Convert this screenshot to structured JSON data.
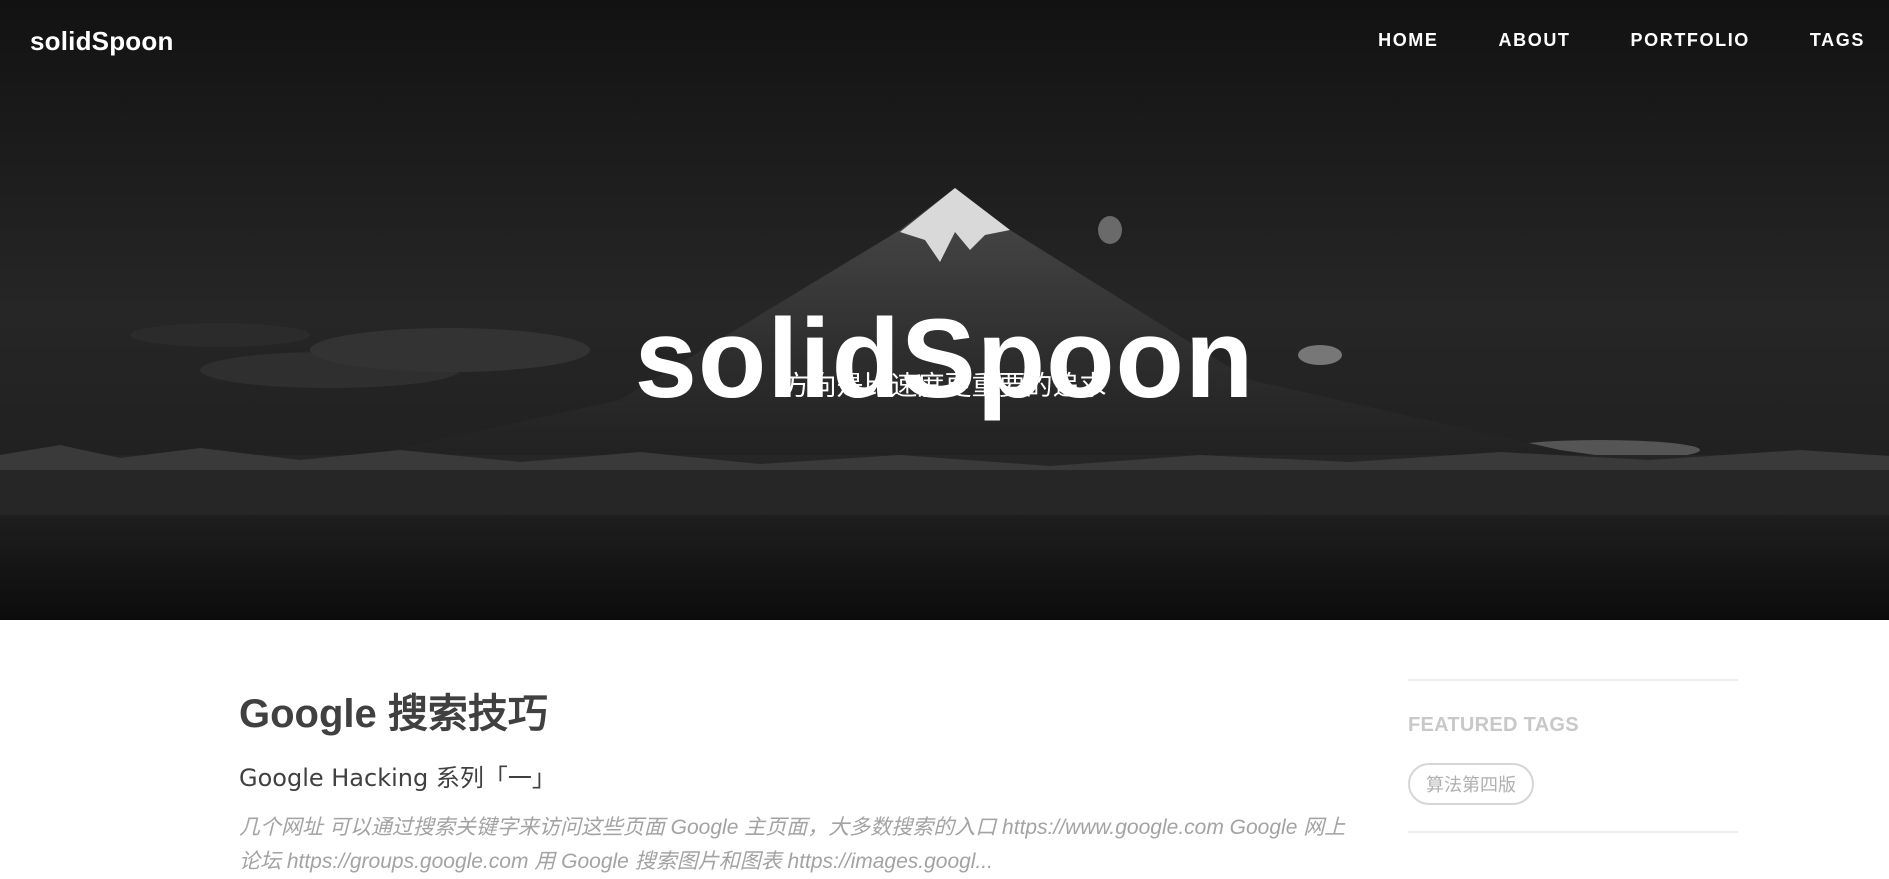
{
  "nav": {
    "brand": "solidSpoon",
    "links": [
      "HOME",
      "ABOUT",
      "PORTFOLIO",
      "TAGS"
    ]
  },
  "hero": {
    "title": "solidSpoon",
    "subtitle": "方向是比速度更重要的追求"
  },
  "post": {
    "title": "Google 搜索技巧",
    "subtitle": "Google Hacking 系列「一」",
    "excerpt": "几个网址 可以通过搜索关键字来访问这些页面 Google 主页面，大多数搜索的入口 https://www.google.com Google 网上论坛 https://groups.google.com 用 Google 搜索图片和图表 https://images.googl..."
  },
  "sidebar": {
    "heading": "FEATURED TAGS",
    "tags": [
      "算法第四版"
    ]
  },
  "colors": {
    "hero_bg": "#1a1a1a",
    "text_dark": "#404040",
    "text_muted": "#a3a3a3",
    "tag_border": "#d6d6d6"
  }
}
